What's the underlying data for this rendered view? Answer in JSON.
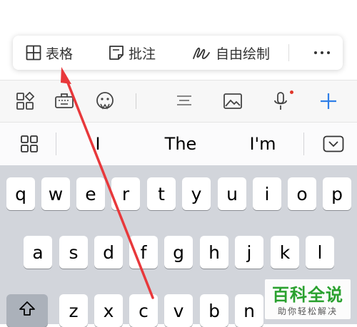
{
  "popup_menu": {
    "items": [
      {
        "label": "表格",
        "icon": "table-icon"
      },
      {
        "label": "批注",
        "icon": "comment-icon"
      },
      {
        "label": "自由绘制",
        "icon": "freehand-draw-icon"
      }
    ],
    "more_icon": "more-icon"
  },
  "toolbar": {
    "icons": [
      "apps-grid-icon",
      "keyboard-briefcase-icon",
      "emoji-icon",
      "align-text-icon",
      "image-icon",
      "microphone-icon",
      "plus-icon"
    ],
    "accent": "#2f7fe8",
    "mic_dot_color": "#e0362a"
  },
  "suggestions": {
    "words": [
      "I",
      "The",
      "I'm"
    ],
    "left_icon": "grid-icon",
    "right_icon": "keyboard-hide-icon"
  },
  "keyboard": {
    "row1": [
      "q",
      "w",
      "e",
      "r",
      "t",
      "y",
      "u",
      "i",
      "o",
      "p"
    ],
    "row2": [
      "a",
      "s",
      "d",
      "f",
      "g",
      "h",
      "j",
      "k",
      "l"
    ],
    "row3": [
      "z",
      "x",
      "c",
      "v",
      "b",
      "n"
    ],
    "shift_icon": "shift-icon"
  },
  "annotation": {
    "arrow_color": "#e8383b"
  },
  "watermark": {
    "title": "百科全说",
    "subtitle": "助你轻松解决"
  }
}
